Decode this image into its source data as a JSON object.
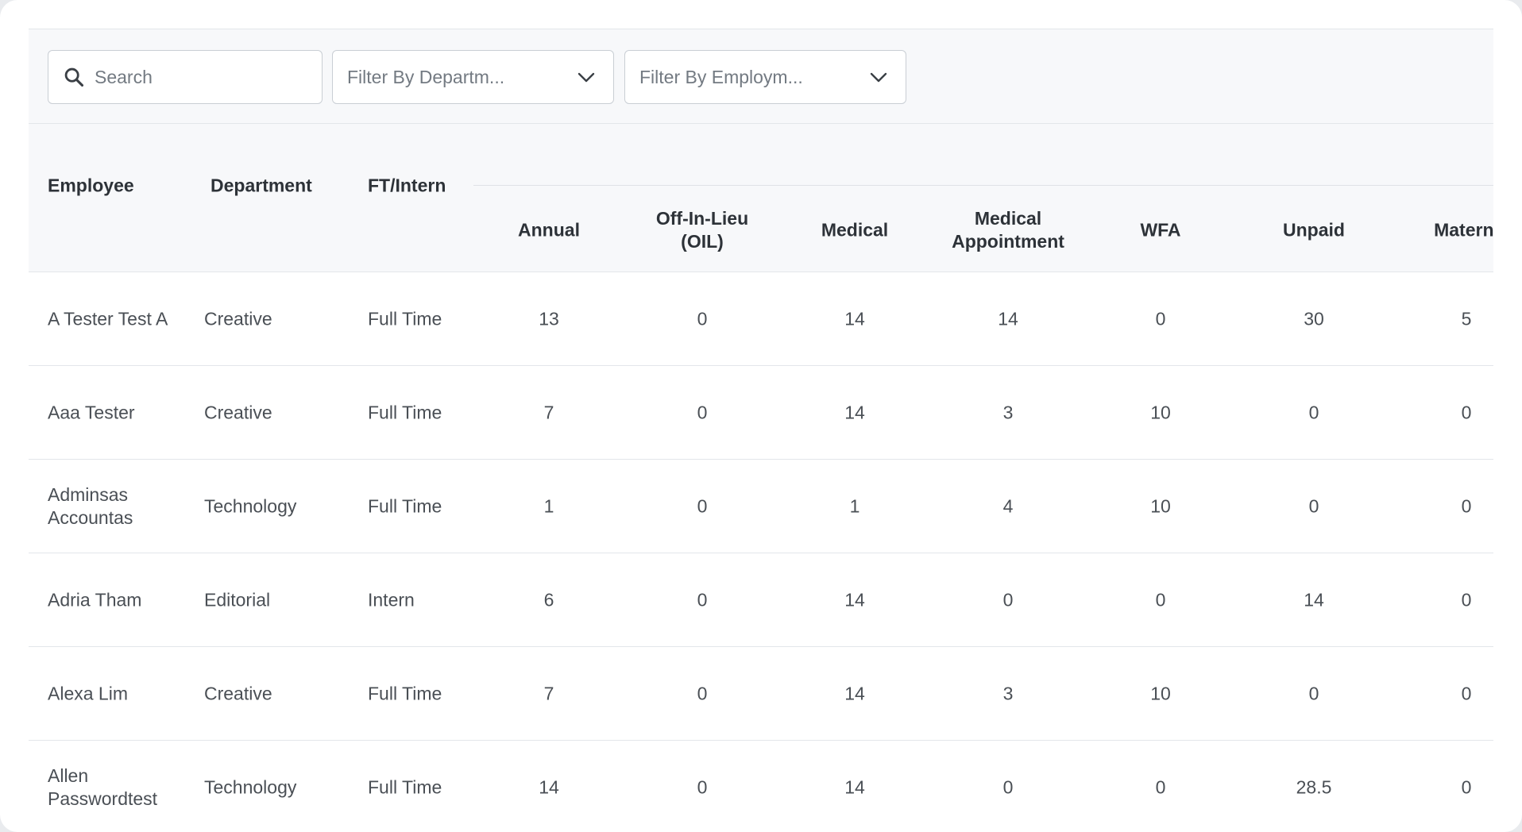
{
  "filters": {
    "search_placeholder": "Search",
    "department_label": "Filter By Departm...",
    "employment_label": "Filter By Employm..."
  },
  "table": {
    "headers": {
      "employee": "Employee",
      "department": "Department",
      "ft_intern": "FT/Intern"
    },
    "leave_columns": [
      "Annual",
      "Off-In-Lieu\n(OIL)",
      "Medical",
      "Medical\nAppointment",
      "WFA",
      "Unpaid",
      "Materni"
    ],
    "rows": [
      {
        "employee": "A Tester Test A",
        "department": "Creative",
        "type": "Full Time",
        "values": [
          "13",
          "0",
          "14",
          "14",
          "0",
          "30",
          "5"
        ]
      },
      {
        "employee": "Aaa Tester",
        "department": "Creative",
        "type": "Full Time",
        "values": [
          "7",
          "0",
          "14",
          "3",
          "10",
          "0",
          "0"
        ]
      },
      {
        "employee": "Adminsas Accountas",
        "department": "Technology",
        "type": "Full Time",
        "values": [
          "1",
          "0",
          "1",
          "4",
          "10",
          "0",
          "0"
        ]
      },
      {
        "employee": "Adria Tham",
        "department": "Editorial",
        "type": "Intern",
        "values": [
          "6",
          "0",
          "14",
          "0",
          "0",
          "14",
          "0"
        ]
      },
      {
        "employee": "Alexa Lim",
        "department": "Creative",
        "type": "Full Time",
        "values": [
          "7",
          "0",
          "14",
          "3",
          "10",
          "0",
          "0"
        ]
      },
      {
        "employee": "Allen Passwordtest",
        "department": "Technology",
        "type": "Full Time",
        "values": [
          "14",
          "0",
          "14",
          "0",
          "0",
          "28.5",
          "0"
        ]
      }
    ]
  },
  "colors": {
    "header_bg": "#f7f8fa",
    "border": "#e3e6ea",
    "text": "#4a4f55"
  }
}
